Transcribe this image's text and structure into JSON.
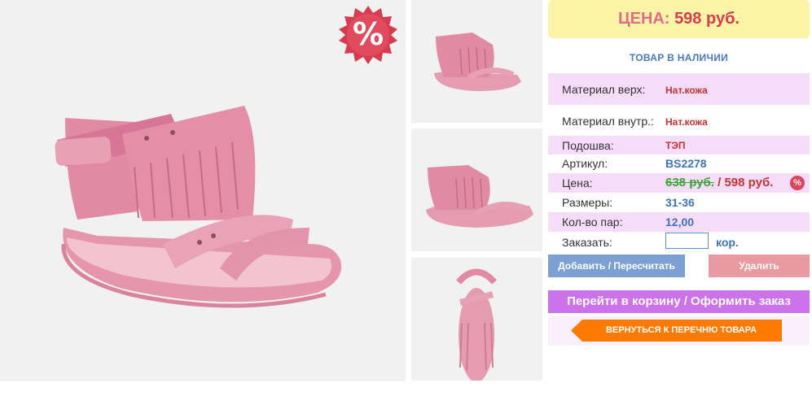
{
  "badge": {
    "symbol": "%"
  },
  "price_banner": {
    "label": "ЦЕНА:",
    "value": "598 руб."
  },
  "stock_status": "ТОВАР В НАЛИЧИИ",
  "properties": [
    {
      "key": "Материал верх:",
      "value": "Нат.кожа"
    },
    {
      "key": "Материал внутр.:",
      "value": "Нат.кожа"
    },
    {
      "key": "Подошва:",
      "value": "ТЭП"
    },
    {
      "key": "Артикул:",
      "value": "BS2278"
    },
    {
      "key": "Цена:",
      "old_price": "638 руб.",
      "separator": " / ",
      "new_price": "598 руб.",
      "badge": "%"
    },
    {
      "key": "Размеры:",
      "value": "31-36"
    },
    {
      "key": "Кол-во пар:",
      "value": "12,00"
    },
    {
      "key": "Заказать:",
      "input_value": "",
      "unit": "кор."
    }
  ],
  "buttons": {
    "add": "Добавить / Пересчитать",
    "delete": "Удалить",
    "cart": "Перейти в корзину / Оформить заказ",
    "back": "ВЕРНУТЬСЯ К ПЕРЕЧНЮ ТОВАРА"
  },
  "colors": {
    "row_shade": "#f5dcf8",
    "price_banner_bg": "#fbf3a6",
    "accent_blue": "#3f74bd",
    "accent_red": "#c8322f",
    "cart_button": "#cc72ea",
    "back_button": "#ff7a00"
  }
}
